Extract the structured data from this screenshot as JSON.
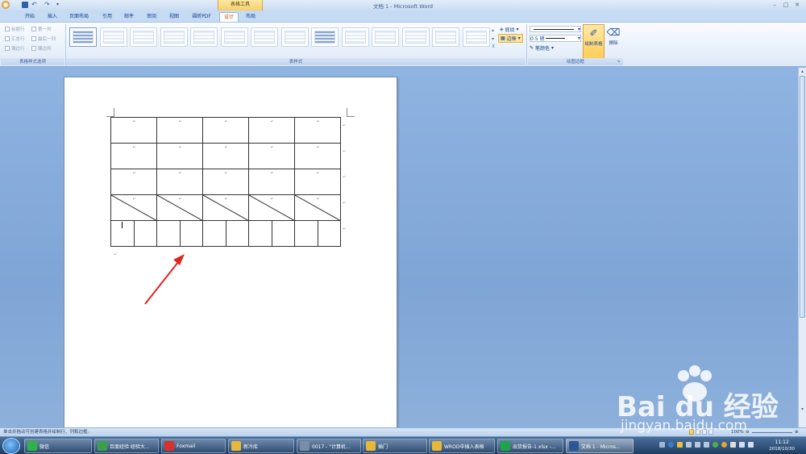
{
  "window": {
    "title": "文档 1 - Microsoft Word",
    "context_tab_group": "表格工具",
    "controls": {
      "minimize": "–",
      "maximize": "□",
      "close": "✕"
    }
  },
  "tabs": [
    {
      "label": "开始",
      "active": false
    },
    {
      "label": "插入",
      "active": false
    },
    {
      "label": "页面布局",
      "active": false
    },
    {
      "label": "引用",
      "active": false
    },
    {
      "label": "邮件",
      "active": false
    },
    {
      "label": "审阅",
      "active": false
    },
    {
      "label": "视图",
      "active": false
    },
    {
      "label": "福昕PDF",
      "active": false
    },
    {
      "label": "设计",
      "active": true
    },
    {
      "label": "布局",
      "active": false
    }
  ],
  "ribbon": {
    "style_options": {
      "label": "表格样式选项",
      "checkboxes": [
        "标题行",
        "第一列",
        "汇总行",
        "最后一列",
        "镶边行",
        "镶边列"
      ]
    },
    "table_styles": {
      "label": "表样式",
      "count": 14
    },
    "shading_label": "底纹",
    "borders_label": "边框",
    "line_weight": "0.5 磅",
    "pen_color": "笔颜色",
    "draw_table": "绘制表格",
    "eraser": "擦除",
    "draw_borders_label": "绘图边框"
  },
  "document": {
    "paragraph_mark": "↵"
  },
  "status_bar": {
    "message": "单击并拖动可创建表格并绘制行、列和边框。",
    "zoom": "100%"
  },
  "taskbar": {
    "items": [
      {
        "label": "微信",
        "icon": "wechat-icon",
        "color": "#2fb344"
      },
      {
        "label": "百度经验 经验大...",
        "icon": "browser-icon",
        "color": "#3aa14a"
      },
      {
        "label": "Foxmail",
        "icon": "foxmail-icon",
        "color": "#d9302c"
      },
      {
        "label": "新冷库",
        "icon": "folder-icon",
        "color": "#e8b83a"
      },
      {
        "label": "0017 - \"计算机...",
        "icon": "search-icon",
        "color": "#7a8da8"
      },
      {
        "label": "插门",
        "icon": "folder-icon",
        "color": "#e8b83a"
      },
      {
        "label": "WROD中插入表格",
        "icon": "folder-icon",
        "color": "#e8b83a"
      },
      {
        "label": "出货报告-1.xlsx -...",
        "icon": "spreadsheet-icon",
        "color": "#1ea44b"
      },
      {
        "label": "文档 1 - Micros...",
        "icon": "word-icon",
        "color": "#2b5797"
      }
    ],
    "clock_time": "11:12",
    "clock_date": "2018/10/30"
  },
  "watermark": {
    "brand": "Bai du 经验",
    "url": "jingyan.baidu.com"
  }
}
